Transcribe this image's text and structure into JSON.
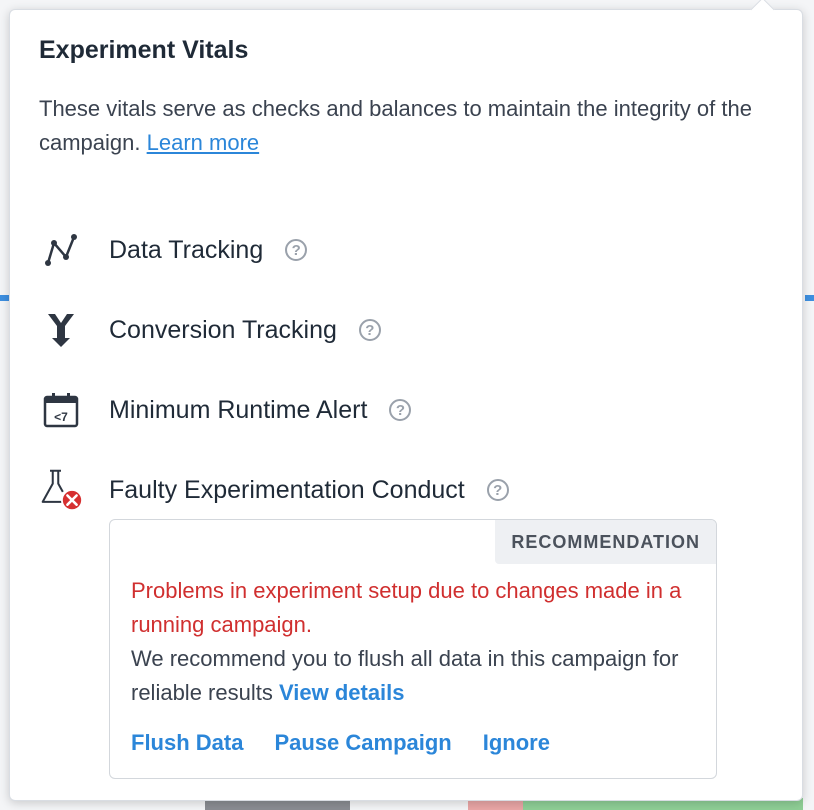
{
  "popover": {
    "title": "Experiment Vitals",
    "description": "These vitals serve as checks and balances to maintain the integrity of the campaign.",
    "learn_more": "Learn more"
  },
  "vitals": [
    {
      "label": "Data Tracking",
      "icon": "line-chart-icon"
    },
    {
      "label": "Conversion Tracking",
      "icon": "funnel-icon"
    },
    {
      "label": "Minimum Runtime Alert",
      "icon": "calendar-icon",
      "icon_text": "<7"
    },
    {
      "label": "Faulty Experimentation Conduct",
      "icon": "flask-error-icon"
    }
  ],
  "help_glyph": "?",
  "recommendation": {
    "tag": "RECOMMENDATION",
    "error": "Problems in experiment setup due to changes made in a running campaign.",
    "body": "We recommend you to flush all data in this campaign for reliable results",
    "view_details": "View details",
    "actions": [
      "Flush Data",
      "Pause Campaign",
      "Ignore"
    ]
  },
  "colors": {
    "link": "#2b86d9",
    "error": "#d02f2f",
    "text": "#1f2a37",
    "error_badge": "#d63031"
  }
}
